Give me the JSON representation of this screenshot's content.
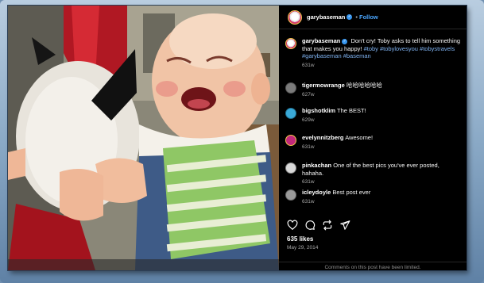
{
  "header": {
    "username": "garybaseman",
    "follow_label": "Follow",
    "separator": "•"
  },
  "caption": {
    "username": "garybaseman",
    "text": "Don't cry! Toby asks to tell him something that makes you happy!",
    "hashtags": "#toby #tobylovesyou #tobystravels #garybaseman #baseman",
    "time": "631w"
  },
  "comments": [
    {
      "username": "tigermowrange",
      "text": "哈哈哈哈哈哈",
      "time": "627w",
      "avatar_color": "#7b7b7b"
    },
    {
      "username": "bigshotklim",
      "text": "The BEST!",
      "time": "629w",
      "avatar_color": "#3aa9d8"
    },
    {
      "username": "evelynnitzberg",
      "text": "Awesome!",
      "time": "631w",
      "avatar_color": "#c2287a"
    },
    {
      "username": "pinkachan",
      "text": "One of the best pics you've ever posted, hahaha.",
      "time": "631w",
      "avatar_color": "#d8d8d8"
    },
    {
      "username": "icleydoyle",
      "text": "Best post ever",
      "time": "631w",
      "avatar_color": "#9a9a9a"
    }
  ],
  "actions": {
    "icons": [
      "heart-icon",
      "comment-icon",
      "repost-icon",
      "share-icon"
    ]
  },
  "likes": "635 likes",
  "date": "May 29, 2014",
  "comments_limited": "Comments on this post have been limited."
}
